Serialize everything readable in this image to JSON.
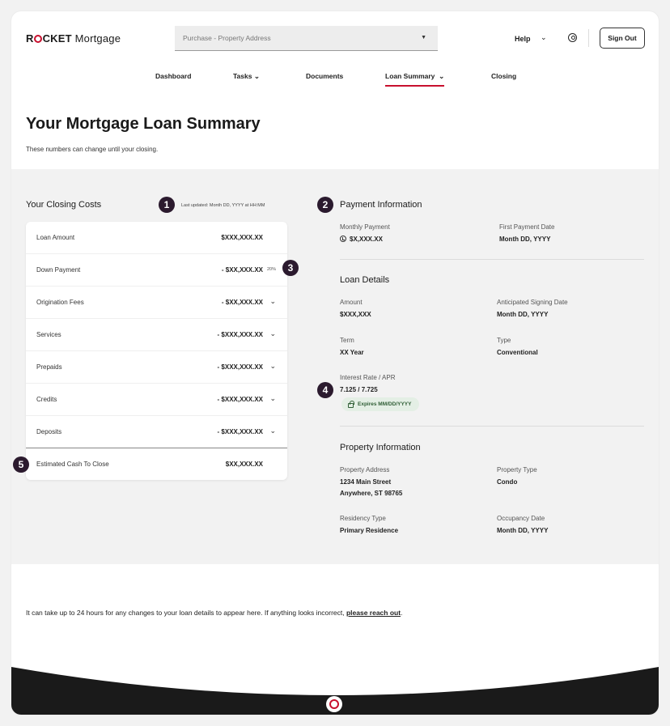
{
  "header": {
    "logo_bold": "R",
    "logo_bold_rest": "CKET",
    "logo_light": "Mortgage",
    "address_select": "Purchase - Property Address",
    "help_label": "Help",
    "sign_out_label": "Sign Out"
  },
  "nav": {
    "dashboard": "Dashboard",
    "tasks": "Tasks",
    "documents": "Documents",
    "loan_summary": "Loan Summary",
    "closing": "Closing"
  },
  "page": {
    "title": "Your Mortgage Loan Summary",
    "subtitle": "These numbers can change until your closing."
  },
  "badges": [
    "1",
    "2",
    "3",
    "4",
    "5"
  ],
  "closing_costs": {
    "heading": "Your Closing Costs",
    "last_updated": "Last updated: Month DD, YYYY at HH:MM",
    "rows": [
      {
        "label": "Loan Amount",
        "value": "$XXX,XXX.XX"
      },
      {
        "label": "Down Payment",
        "value": "- $XX,XXX.XX",
        "pct": "20%"
      },
      {
        "label": "Origination Fees",
        "value": "- $XX,XXX.XX"
      },
      {
        "label": "Services",
        "value": "- $XXX,XXX.XX"
      },
      {
        "label": "Prepaids",
        "value": "- $XXX,XXX.XX"
      },
      {
        "label": "Credits",
        "value": "- $XXX,XXX.XX"
      },
      {
        "label": "Deposits",
        "value": "- $XXX,XXX.XX"
      }
    ],
    "total": {
      "label": "Estimated Cash To Close",
      "value": "$XX,XXX.XX"
    }
  },
  "payment_info": {
    "heading": "Payment Information",
    "monthly_label": "Monthly Payment",
    "monthly_value": "$X,XXX.XX",
    "first_date_label": "First Payment Date",
    "first_date_value": "Month DD, YYYY"
  },
  "loan_details": {
    "heading": "Loan Details",
    "amount_label": "Amount",
    "amount_value": "$XXX,XXX",
    "signing_label": "Anticipated Signing Date",
    "signing_value": "Month DD, YYYY",
    "term_label": "Term",
    "term_value": "XX Year",
    "type_label": "Type",
    "type_value": "Conventional",
    "rate_label": "Interest Rate / APR",
    "rate_value": "7.125 / 7.725",
    "expires": "Expires MM/DD/YYYY"
  },
  "property_info": {
    "heading": "Property Information",
    "address_label": "Property Address",
    "address_line1": "1234 Main Street",
    "address_line2": "Anywhere, ST 98765",
    "type_label": "Property Type",
    "type_value": "Condo",
    "residency_label": "Residency Type",
    "residency_value": "Primary Residence",
    "occupancy_label": "Occupancy Date",
    "occupancy_value": "Month DD, YYYY"
  },
  "footer": {
    "note": "It can take up to 24 hours for any changes to your loan details to appear here. If anything looks incorrect, ",
    "link": "please reach out",
    "note_end": "."
  },
  "colors": {
    "brand_red": "#c8102e",
    "badge": "#2b1a2e",
    "band": "#f2f2f2",
    "pill_bg": "#e4efe5",
    "pill_text": "#2f5e35"
  }
}
